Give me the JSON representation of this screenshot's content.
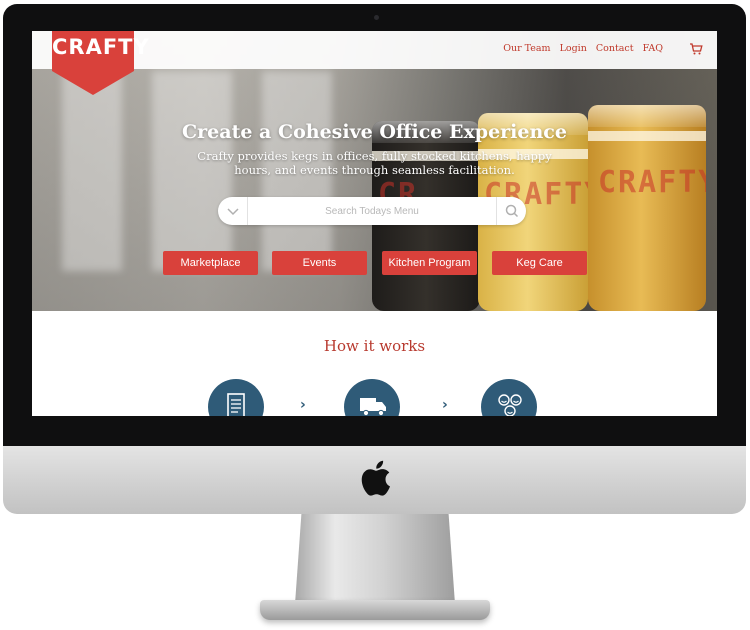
{
  "brand": {
    "logo_text": "CRAFTY",
    "accent": "#d9413b",
    "dark_blue": "#2f5b78"
  },
  "nav": {
    "links": [
      "Our Team",
      "Login",
      "Contact",
      "FAQ"
    ],
    "cart_icon": "cart-icon"
  },
  "hero": {
    "title": "Create a Cohesive Office Experience",
    "subtitle": "Crafty provides kegs in offices, fully stocked kitchens, happy hours, and events through seamless facilitation."
  },
  "search": {
    "placeholder": "Search Todays Menu",
    "dropdown_icon": "chevron-down-icon",
    "search_icon": "search-icon"
  },
  "cta_buttons": [
    "Marketplace",
    "Events",
    "Kitchen Program",
    "Keg Care"
  ],
  "how_it_works": {
    "title": "How it works",
    "steps": [
      {
        "icon": "checklist-icon"
      },
      {
        "icon": "delivery-truck-icon"
      },
      {
        "icon": "happy-people-icon"
      }
    ],
    "arrow": "›"
  }
}
